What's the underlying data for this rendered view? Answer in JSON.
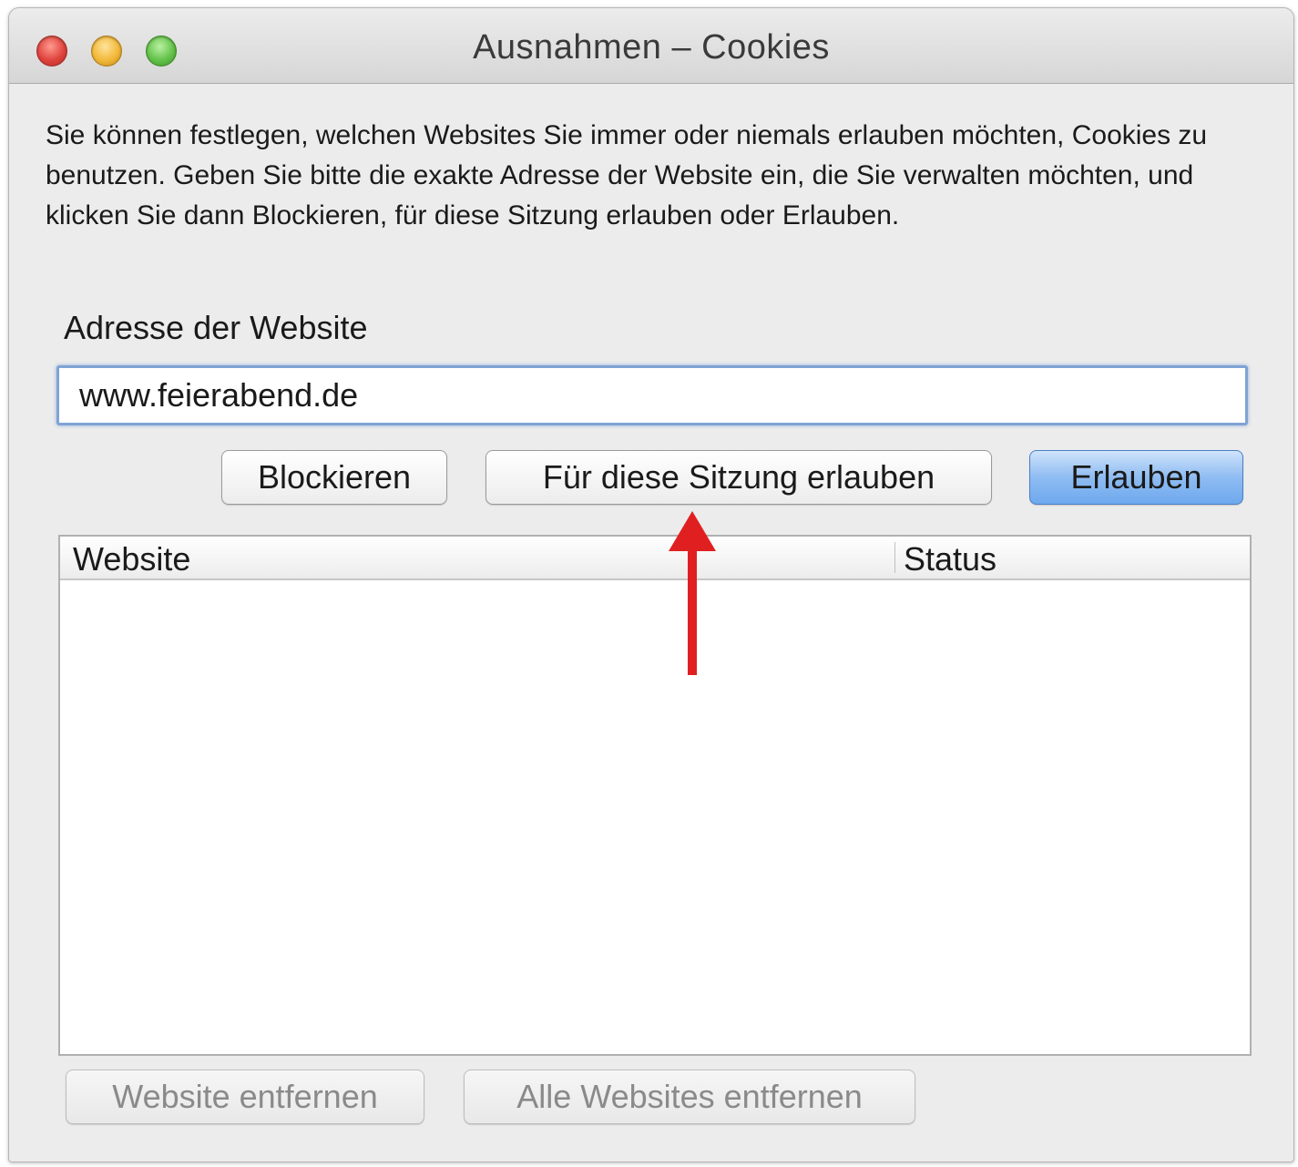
{
  "window": {
    "title": "Ausnahmen – Cookies"
  },
  "description": "Sie können festlegen, welchen Websites Sie immer oder niemals erlauben möchten, Cookies zu benutzen. Geben Sie bitte die exakte Adresse der Website ein, die Sie verwalten möchten, und klicken Sie dann Blockieren, für diese Sitzung erlauben oder Erlauben.",
  "address": {
    "label": "Adresse der Website",
    "value": "www.feierabend.de"
  },
  "actions": {
    "block_label": "Blockieren",
    "session_label": "Für diese Sitzung erlauben",
    "allow_label": "Erlauben"
  },
  "table": {
    "columns": [
      "Website",
      "Status"
    ],
    "rows": []
  },
  "footer": {
    "remove_label": "Website entfernen",
    "remove_all_label": "Alle Websites entfernen"
  },
  "annotation": {
    "arrow_color": "#e02020"
  }
}
